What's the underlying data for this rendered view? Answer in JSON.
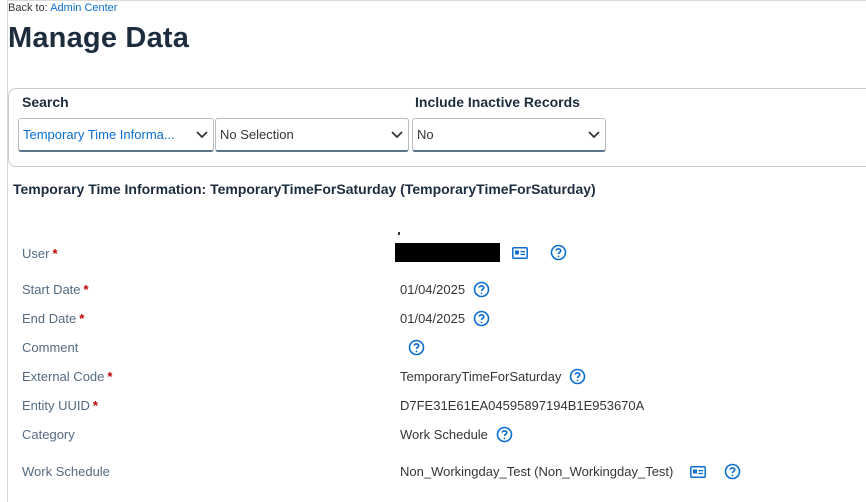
{
  "back": {
    "prefix": "Back to:",
    "link": "Admin Center"
  },
  "page_title": "Manage Data",
  "search": {
    "label": "Search",
    "object_type": "Temporary Time Informa...",
    "record": "No Selection"
  },
  "include_inactive": {
    "label": "Include Inactive Records",
    "value": "No"
  },
  "section_title": "Temporary Time Information: TemporaryTimeForSaturday (TemporaryTimeForSaturday)",
  "fields": {
    "user": {
      "label": "User",
      "required": "*"
    },
    "start_date": {
      "label": "Start Date",
      "required": "*",
      "value": "01/04/2025"
    },
    "end_date": {
      "label": "End Date",
      "required": "*",
      "value": "01/04/2025"
    },
    "comment": {
      "label": "Comment"
    },
    "external_code": {
      "label": "External Code",
      "required": "*",
      "value": "TemporaryTimeForSaturday"
    },
    "entity_uuid": {
      "label": "Entity UUID",
      "required": "*",
      "value": "D7FE31E61EA04595897194B1E953670A"
    },
    "category": {
      "label": "Category",
      "value": "Work Schedule"
    },
    "work_schedule": {
      "label": "Work Schedule",
      "value": "Non_Workingday_Test (Non_Workingday_Test)"
    }
  },
  "colors": {
    "link": "#0a6ed1",
    "required": "#bb0000",
    "title": "#1d2d3e",
    "label": "#556b82"
  },
  "icons": [
    "chevron-down-icon",
    "help-icon",
    "business-card-icon"
  ]
}
